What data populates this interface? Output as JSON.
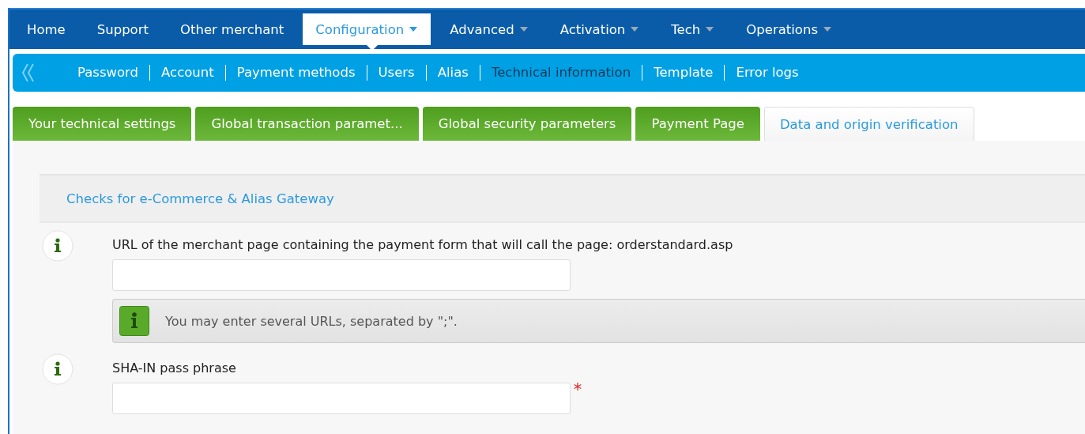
{
  "main_nav": [
    {
      "label": "Home",
      "dropdown": false,
      "selected": false
    },
    {
      "label": "Support",
      "dropdown": false,
      "selected": false
    },
    {
      "label": "Other merchant",
      "dropdown": false,
      "selected": false
    },
    {
      "label": "Configuration",
      "dropdown": true,
      "selected": true
    },
    {
      "label": "Advanced",
      "dropdown": true,
      "selected": false
    },
    {
      "label": "Activation",
      "dropdown": true,
      "selected": false
    },
    {
      "label": "Tech",
      "dropdown": true,
      "selected": false
    },
    {
      "label": "Operations",
      "dropdown": true,
      "selected": false
    }
  ],
  "sub_nav": [
    {
      "label": "Password",
      "selected": false
    },
    {
      "label": "Account",
      "selected": false
    },
    {
      "label": "Payment methods",
      "selected": false
    },
    {
      "label": "Users",
      "selected": false
    },
    {
      "label": "Alias",
      "selected": false
    },
    {
      "label": "Technical information",
      "selected": true
    },
    {
      "label": "Template",
      "selected": false
    },
    {
      "label": "Error logs",
      "selected": false
    }
  ],
  "tabs": [
    {
      "label": "Your technical settings",
      "selected": false
    },
    {
      "label": "Global transaction paramet...",
      "selected": false
    },
    {
      "label": "Global security parameters",
      "selected": false
    },
    {
      "label": "Payment Page",
      "selected": false
    },
    {
      "label": "Data and origin verification",
      "selected": true
    }
  ],
  "section": {
    "title": "Checks for e-Commerce & Alias Gateway"
  },
  "fields": [
    {
      "label": "URL of the merchant page containing the payment form that will call the page: orderstandard.asp",
      "required": false,
      "hint": "You may enter several URLs, separated by \";\"."
    },
    {
      "label": "SHA-IN pass phrase",
      "required": true
    }
  ]
}
